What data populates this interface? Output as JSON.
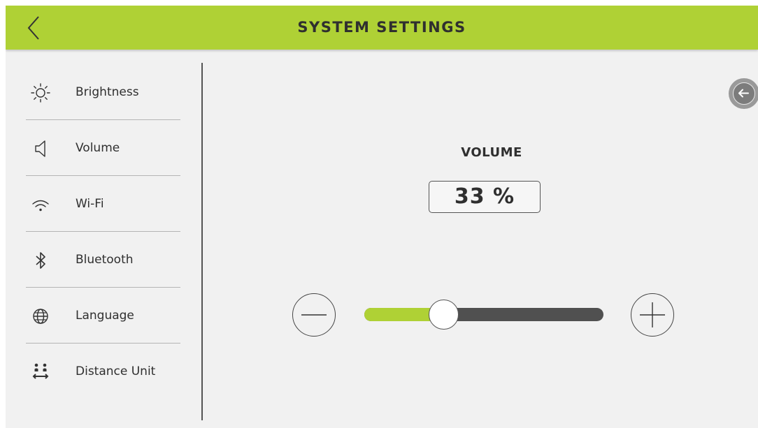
{
  "header": {
    "title": "SYSTEM SETTINGS",
    "back_icon": "chevron-left-icon"
  },
  "sidebar": {
    "items": [
      {
        "label": "Brightness",
        "icon": "sun-icon"
      },
      {
        "label": "Volume",
        "icon": "speaker-icon"
      },
      {
        "label": "Wi-Fi",
        "icon": "wifi-icon"
      },
      {
        "label": "Bluetooth",
        "icon": "bluetooth-icon"
      },
      {
        "label": "Language",
        "icon": "globe-icon"
      },
      {
        "label": "Distance Unit",
        "icon": "distance-unit-icon"
      }
    ]
  },
  "main": {
    "section_title": "VOLUME",
    "value_display": "33 %",
    "volume_level": 0.33,
    "minus_icon": "minus-icon",
    "plus_icon": "plus-icon",
    "collapse_icon": "arrow-left-icon"
  },
  "colors": {
    "accent": "#afd135",
    "track": "#505050",
    "background": "#f1f1f1",
    "text": "#2f2f2f"
  }
}
